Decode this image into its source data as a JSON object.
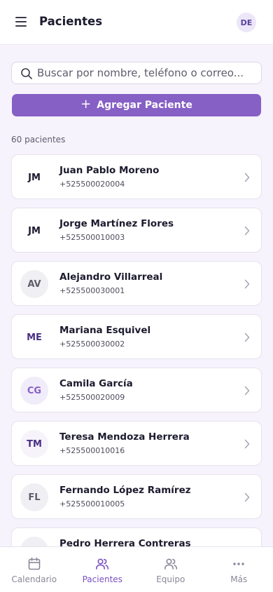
{
  "header": {
    "title": "Pacientes",
    "user_initials": "DE"
  },
  "search": {
    "placeholder": "Buscar por nombre, teléfono o correo...",
    "value": ""
  },
  "add_button": {
    "label": "Agregar Paciente",
    "icon": "plus-icon"
  },
  "count_label": "60 pacientes",
  "patients": [
    {
      "initials": "JM",
      "name": "Juan Pablo Moreno",
      "phone": "+525500020004",
      "avatar_bg": "#ffffff",
      "avatar_fg": "#1c1b2e"
    },
    {
      "initials": "JM",
      "name": "Jorge Martínez Flores",
      "phone": "+525500010003",
      "avatar_bg": "#ffffff",
      "avatar_fg": "#1c1b2e"
    },
    {
      "initials": "AV",
      "name": "Alejandro Villarreal",
      "phone": "+525500030001",
      "avatar_bg": "#f0eff3",
      "avatar_fg": "#5f5d6c"
    },
    {
      "initials": "ME",
      "name": "Mariana Esquivel",
      "phone": "+525500030002",
      "avatar_bg": "#ffffff",
      "avatar_fg": "#4a2f86"
    },
    {
      "initials": "CG",
      "name": "Camila García",
      "phone": "+525500020009",
      "avatar_bg": "#f1ecfa",
      "avatar_fg": "#8660c5"
    },
    {
      "initials": "TM",
      "name": "Teresa Mendoza Herrera",
      "phone": "+525500010016",
      "avatar_bg": "#f6f3fb",
      "avatar_fg": "#4a2f86"
    },
    {
      "initials": "FL",
      "name": "Fernando López Ramírez",
      "phone": "+525500010005",
      "avatar_bg": "#f0eff3",
      "avatar_fg": "#5f5d6c"
    },
    {
      "initials": "",
      "name": "Pedro Herrera Contreras",
      "phone": "",
      "avatar_bg": "#f0eff3",
      "avatar_fg": "#5f5d6c"
    }
  ],
  "bottom_nav": [
    {
      "label": "Calendario",
      "icon": "calendar-icon",
      "active": false
    },
    {
      "label": "Pacientes",
      "icon": "users-icon",
      "active": true
    },
    {
      "label": "Equipo",
      "icon": "team-icon",
      "active": false
    },
    {
      "label": "Más",
      "icon": "more-icon",
      "active": false
    }
  ],
  "colors": {
    "accent": "#8660c5",
    "active_nav": "#7a4fc2",
    "background": "#f6f3fc"
  }
}
